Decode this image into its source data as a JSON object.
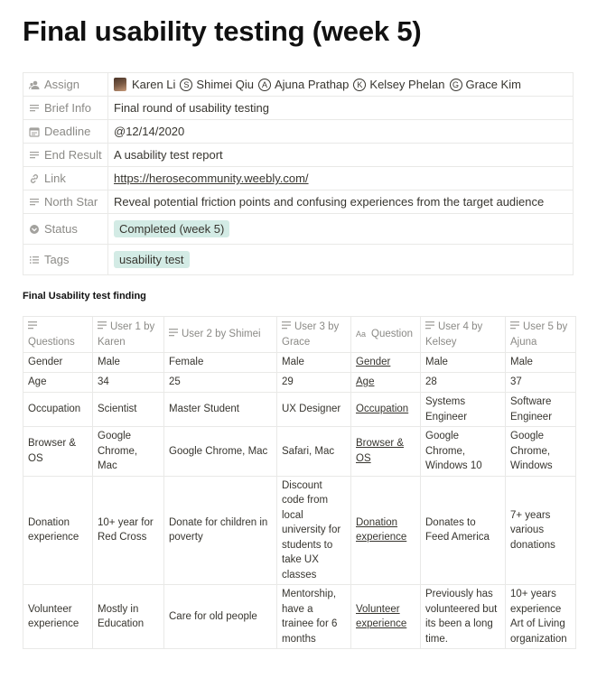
{
  "page": {
    "title": "Final usability testing (week 5)"
  },
  "properties": {
    "assign": {
      "label": "Assign",
      "people": [
        {
          "name": "Karen Li",
          "avatar_letter": ""
        },
        {
          "name": "Shimei Qiu",
          "avatar_letter": "S"
        },
        {
          "name": "Ajuna Prathap",
          "avatar_letter": "A"
        },
        {
          "name": "Kelsey Phelan",
          "avatar_letter": "K"
        },
        {
          "name": "Grace Kim",
          "avatar_letter": "G"
        }
      ]
    },
    "brief_info": {
      "label": "Brief Info",
      "value": "Final round of usability testing"
    },
    "deadline": {
      "label": "Deadline",
      "value": "@12/14/2020"
    },
    "end_result": {
      "label": "End Result",
      "value": "A usability test report"
    },
    "link": {
      "label": "Link",
      "value": "https://herosecommunity.weebly.com/"
    },
    "north_star": {
      "label": "North Star",
      "value": "Reveal potential friction points and confusing experiences from the target audience"
    },
    "status": {
      "label": "Status",
      "value": "Completed (week 5)",
      "color": "#d3ebe5"
    },
    "tags": {
      "label": "Tags",
      "value": "usability test",
      "color": "#d3ebe5"
    }
  },
  "findings": {
    "title": "Final Usability test finding",
    "columns": [
      "Questions",
      "User 1 by Karen",
      "User 2 by Shimei",
      "User 3 by Grace",
      "Question",
      "User 4 by Kelsey",
      "User 5 by Ajuna"
    ],
    "rows": [
      [
        "Gender",
        "Male",
        "Female",
        "Male",
        "Gender",
        "Male",
        "Male"
      ],
      [
        "Age",
        "34",
        "25",
        "29",
        "Age",
        "28",
        "37"
      ],
      [
        "Occupation",
        "Scientist",
        "Master Student",
        "UX Designer",
        "Occupation",
        "Systems Engineer",
        "Software Engineer"
      ],
      [
        "Browser & OS",
        "Google Chrome, Mac",
        "Google Chrome, Mac",
        "Safari, Mac",
        "Browser & OS",
        "Google Chrome, Windows 10",
        "Google Chrome, Windows"
      ],
      [
        "Donation experience",
        "10+ year for Red Cross",
        "Donate for children in poverty",
        "Discount code from local university for students to take UX classes",
        "Donation experience",
        "Donates to Feed America",
        "7+ years various donations"
      ],
      [
        "Volunteer experience",
        "Mostly in Education",
        "Care for old people",
        "Mentorship, have a trainee for 6 months",
        "Volunteer experience",
        "Previously has volunteered but its been a long time.",
        "10+ years experience Art of Living organization"
      ]
    ]
  }
}
